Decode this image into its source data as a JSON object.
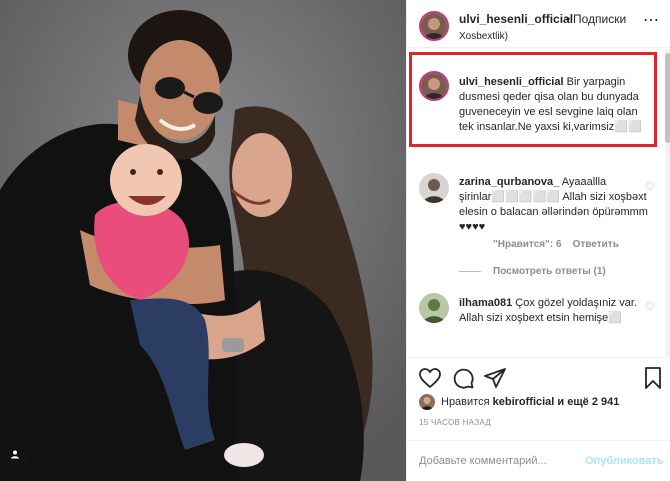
{
  "post": {
    "username": "ulvi_hesenli_official",
    "follow_label": "Подписки",
    "location": "Xosbextlik)",
    "caption_username": "ulvi_hesenli_official",
    "caption_text": "Bir yarpagin dusmesi qeder qisa olan bu dunyada guveneceyin ve esl sevgine laiq olan tek insanlar.Ne yaxsi ki,varimsiz⬜⬜",
    "highlight_color": "#e0262c"
  },
  "comments": [
    {
      "username": "zarina_qurbanova_",
      "text": "Ayaaallla şirinlar⬜⬜⬜⬜⬜ Allah sizi xoşbəxt elesin o balacan əllərindən öpürəmmm ♥♥♥♥",
      "likes": "\"Нравится\": 6",
      "reply": "Ответить",
      "view_replies": "Посмотреть ответы (1)"
    },
    {
      "username": "ilhama081",
      "text": "Çox gözel yoldaşıniz var. Allah sizi xoşbext etsin hemişe⬜"
    }
  ],
  "likes": {
    "prefix": "Нравится",
    "user": "kebirofficial",
    "suffix": "и ещё 2 941"
  },
  "time_ago": "15 ЧАСОВ НАЗАД",
  "add_comment": {
    "placeholder": "Добавьте комментарий...",
    "post_label": "Опубликовать"
  },
  "icons": [
    "heart-icon",
    "comment-icon",
    "share-icon",
    "bookmark-icon",
    "more-icon"
  ]
}
